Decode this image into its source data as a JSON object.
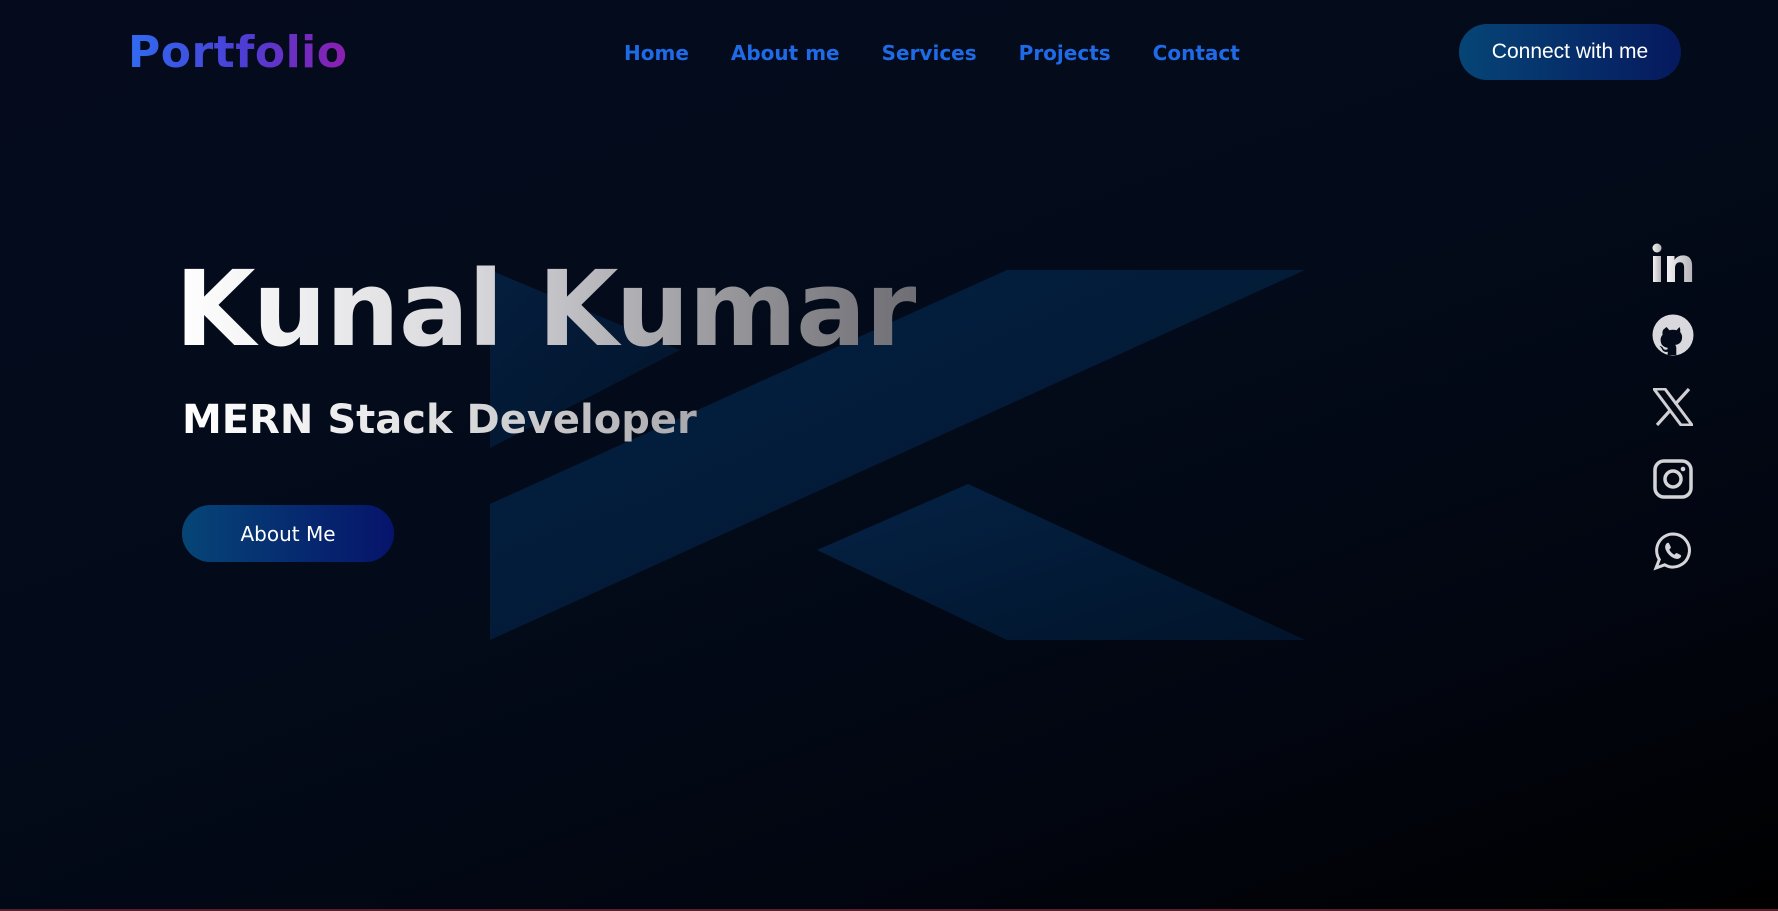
{
  "header": {
    "logo": "Portfolio",
    "nav": [
      {
        "label": "Home"
      },
      {
        "label": "About me"
      },
      {
        "label": "Services"
      },
      {
        "label": "Projects"
      },
      {
        "label": "Contact"
      }
    ],
    "cta_label": "Connect with me"
  },
  "hero": {
    "name": "Kunal Kumar",
    "role": "MERN Stack Developer",
    "button_label": "About Me"
  },
  "socials": [
    {
      "icon": "linkedin-icon"
    },
    {
      "icon": "github-icon"
    },
    {
      "icon": "x-icon"
    },
    {
      "icon": "instagram-icon"
    },
    {
      "icon": "whatsapp-icon"
    }
  ],
  "colors": {
    "nav_link": "#1f6ae6",
    "button_gradient_start": "#064576",
    "button_gradient_end": "#06195e",
    "background": "#030b1a"
  }
}
